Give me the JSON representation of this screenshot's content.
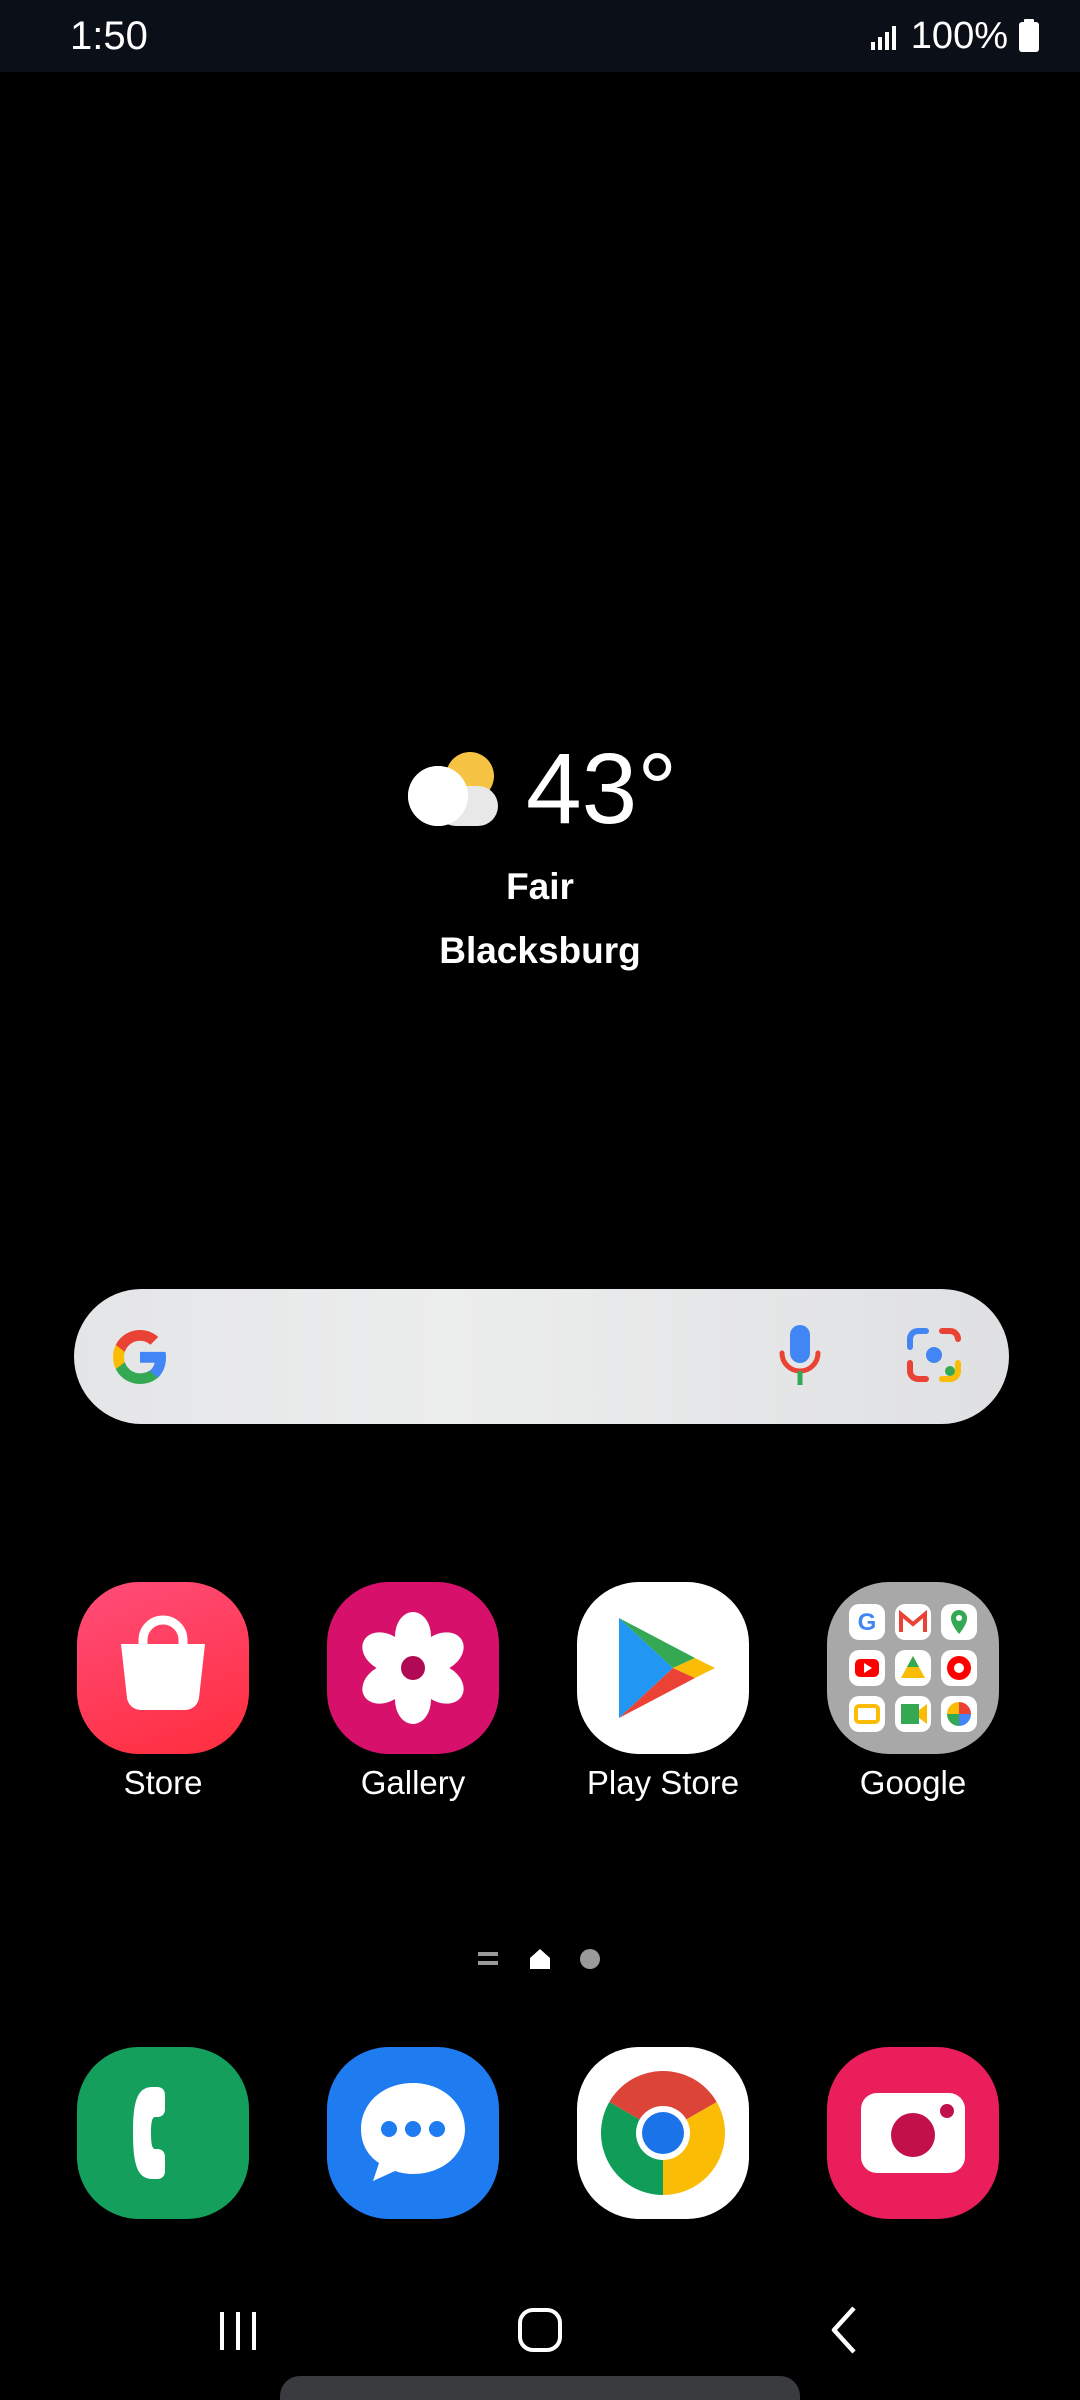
{
  "status_bar": {
    "time": "1:50",
    "battery": "100%",
    "icons": [
      "signal-icon",
      "battery-icon"
    ]
  },
  "weather": {
    "temperature": "43°",
    "condition": "Fair",
    "location": "Blacksburg",
    "icon": "partly-cloudy-icon"
  },
  "search": {
    "icons": [
      "google-g-icon",
      "microphone-icon",
      "google-lens-icon"
    ]
  },
  "apps": [
    {
      "label": "Store",
      "icon": "galaxy-store-icon",
      "color": "#ff3d6e"
    },
    {
      "label": "Gallery",
      "icon": "gallery-flower-icon",
      "color": "#d6106b"
    },
    {
      "label": "Play Store",
      "icon": "play-store-icon",
      "color": "#ffffff"
    },
    {
      "label": "Google",
      "icon": "google-folder-icon",
      "color": "#a3a3a3"
    }
  ],
  "dock": [
    {
      "name": "Phone",
      "icon": "phone-icon",
      "color": "#14a05c"
    },
    {
      "name": "Messages",
      "icon": "messages-icon",
      "color": "#1f7bf0"
    },
    {
      "name": "Chrome",
      "icon": "chrome-icon",
      "color": "#ffffff"
    },
    {
      "name": "Camera",
      "icon": "camera-icon",
      "color": "#e91e5a"
    }
  ],
  "page_indicator": {
    "pages": 3,
    "current": 1
  },
  "nav_bar": {
    "buttons": [
      "recents-icon",
      "home-icon",
      "back-icon"
    ]
  }
}
